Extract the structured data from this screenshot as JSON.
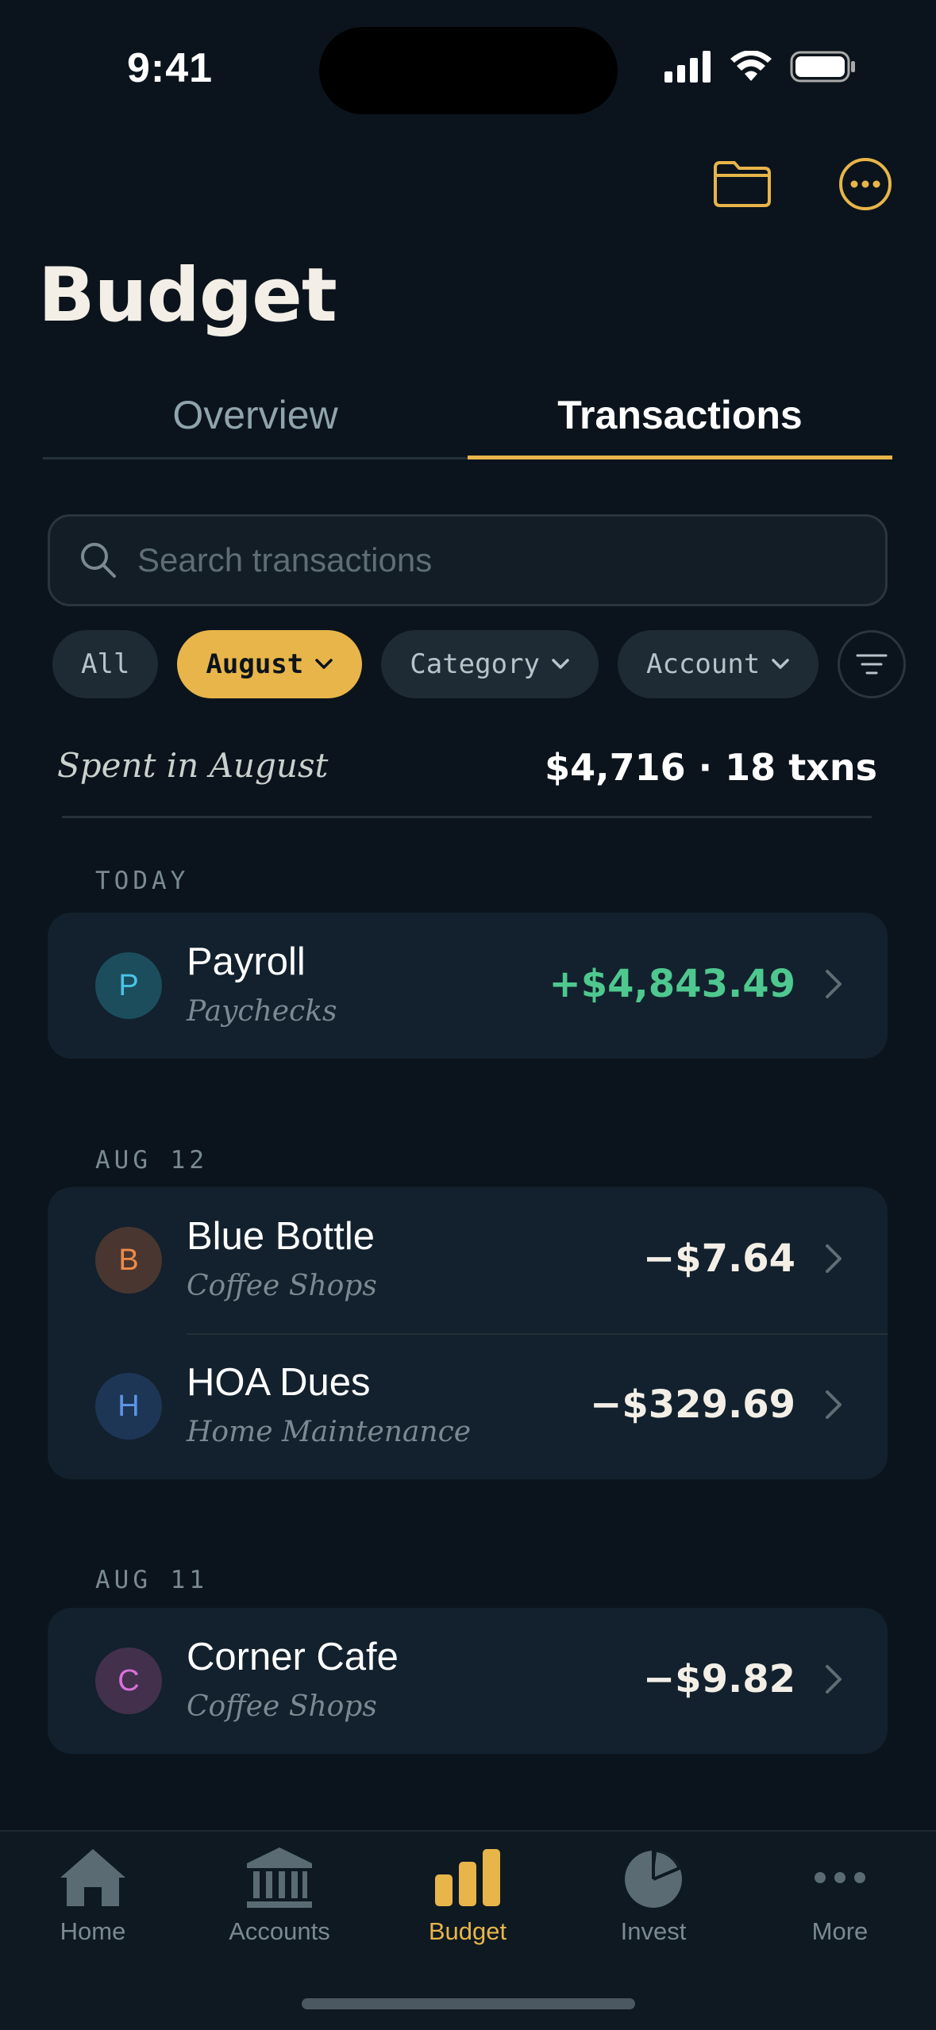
{
  "status_bar": {
    "time": "9:41"
  },
  "title": "Budget",
  "tabs": [
    {
      "label": "Overview",
      "active": false
    },
    {
      "label": "Transactions",
      "active": true
    }
  ],
  "search": {
    "placeholder": "Search transactions",
    "value": ""
  },
  "filters": [
    {
      "label": "All",
      "active": false,
      "dropdown": false
    },
    {
      "label": "August",
      "active": true,
      "dropdown": true
    },
    {
      "label": "Category",
      "active": false,
      "dropdown": true
    },
    {
      "label": "Account",
      "active": false,
      "dropdown": true
    }
  ],
  "summary": {
    "label": "Spent in August",
    "value": "$4,716 · 18 txns"
  },
  "sections": [
    {
      "label": "TODAY",
      "transactions": [
        {
          "initial": "P",
          "merchant": "Payroll",
          "category": "Paychecks",
          "amount": "+$4,843.49"
        }
      ]
    },
    {
      "label": "AUG 12",
      "transactions": [
        {
          "initial": "B",
          "merchant": "Blue Bottle",
          "category": "Coffee Shops",
          "amount": "−$7.64"
        },
        {
          "initial": "H",
          "merchant": "HOA Dues",
          "category": "Home Maintenance",
          "amount": "−$329.69"
        }
      ]
    },
    {
      "label": "AUG 11",
      "transactions": [
        {
          "initial": "C",
          "merchant": "Corner Cafe",
          "category": "Coffee Shops",
          "amount": "−$9.82"
        }
      ]
    }
  ],
  "tabbar": [
    {
      "label": "Home",
      "icon": "house-icon",
      "active": false
    },
    {
      "label": "Accounts",
      "icon": "bank-icon",
      "active": false
    },
    {
      "label": "Budget",
      "icon": "bar-chart-icon",
      "active": true
    },
    {
      "label": "Invest",
      "icon": "pie-chart-icon",
      "active": false
    },
    {
      "label": "More",
      "icon": "ellipsis-icon",
      "active": false
    }
  ],
  "colors": {
    "background": "#0b141c",
    "accent": "#e8b54a",
    "positive": "#4ec88f",
    "card": "#12212d",
    "muted": "#7b8a92"
  }
}
